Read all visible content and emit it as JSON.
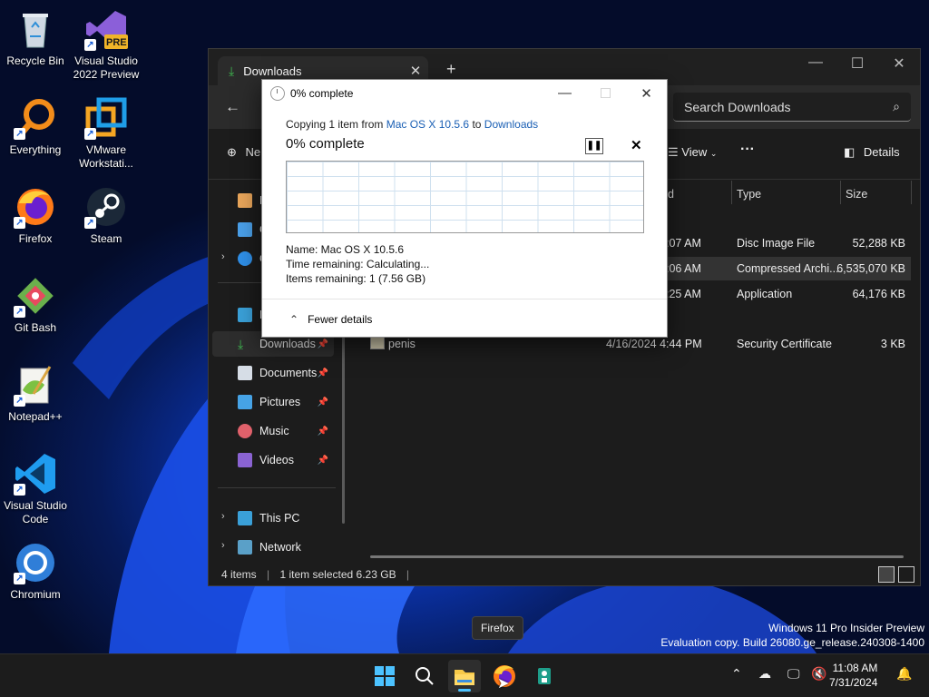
{
  "desktop": {
    "icons": [
      {
        "label": "Recycle Bin"
      },
      {
        "label": "Visual Studio 2022 Preview",
        "badge": "PRE"
      },
      {
        "label": "Everything"
      },
      {
        "label": "VMware Workstati..."
      },
      {
        "label": "Firefox"
      },
      {
        "label": "Steam"
      },
      {
        "label": "Git Bash"
      },
      {
        "label": "Notepad++"
      },
      {
        "label": "Visual Studio Code"
      },
      {
        "label": "Chromium"
      }
    ]
  },
  "explorer": {
    "tab_title": "Downloads",
    "search_placeholder": "Search Downloads",
    "toolbar": {
      "new_label": "Ne",
      "view_label": "View",
      "more_label": "···",
      "details_label": "Details"
    },
    "nav": {
      "home": "H",
      "gallery": "G",
      "onedrive": "O",
      "desktop": "D",
      "downloads": "Downloads",
      "documents": "Documents",
      "pictures": "Pictures",
      "music": "Music",
      "videos": "Videos",
      "this_pc": "This PC",
      "network": "Network"
    },
    "columns": {
      "date": "d",
      "type": "Type",
      "size": "Size"
    },
    "rows": [
      {
        "name": "",
        "date": ":07 AM",
        "type": "Disc Image File",
        "size": "52,288 KB"
      },
      {
        "name": "",
        "date": ":06 AM",
        "type": "Compressed Archi...",
        "size": "6,535,070 KB"
      },
      {
        "name": "",
        "date": ":25 AM",
        "type": "Application",
        "size": "64,176 KB"
      },
      {
        "name": "penis",
        "date": "4/16/2024 4:44 PM",
        "type": "Security Certificate",
        "size": "3 KB"
      }
    ],
    "status": {
      "items": "4 items",
      "selected": "1 item selected  6.23 GB"
    }
  },
  "copy_dialog": {
    "title": "0% complete",
    "copying_prefix": "Copying 1 item from ",
    "source": "Mac OS X 10.5.6",
    "to_word": " to ",
    "destination": "Downloads",
    "percent": "0% complete",
    "progress": 0,
    "details": {
      "name": "Name:  Mac OS X 10.5.6",
      "time_remaining": "Time remaining:  Calculating...",
      "items_remaining": "Items remaining:  1 (7.56 GB)"
    },
    "fewer_details": "Fewer details"
  },
  "tooltip": "Firefox",
  "watermark": {
    "line1": "Windows 11 Pro Insider Preview",
    "line2": "Evaluation copy. Build 26080.ge_release.240308-1400"
  },
  "taskbar": {
    "time": "11:08 AM",
    "date": "7/31/2024"
  },
  "colors": {
    "accent": "#4cc2ff",
    "link": "#1a5fb4",
    "explorer_bg": "#1c1c1c"
  }
}
